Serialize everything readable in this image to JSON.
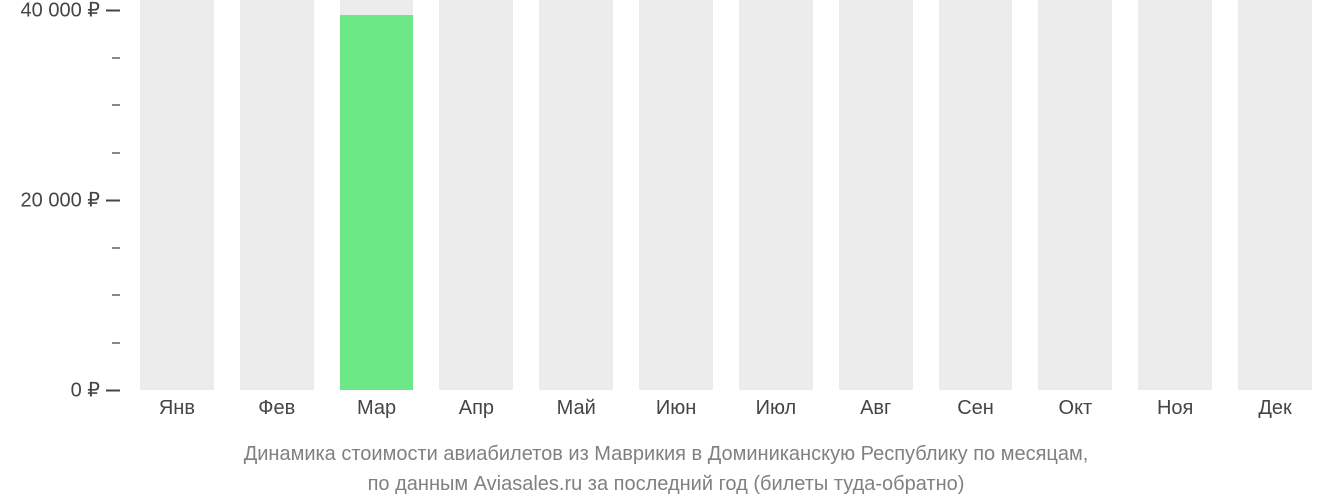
{
  "chart_data": {
    "type": "bar",
    "categories": [
      "Янв",
      "Фев",
      "Мар",
      "Апр",
      "Май",
      "Июн",
      "Июл",
      "Авг",
      "Сен",
      "Окт",
      "Ноя",
      "Дек"
    ],
    "values": [
      null,
      null,
      39500,
      null,
      null,
      null,
      null,
      null,
      null,
      null,
      null,
      null
    ],
    "ylabel": "",
    "xlabel": "",
    "ylim": [
      0,
      40000
    ],
    "y_ticks_major": [
      0,
      20000,
      40000
    ],
    "y_ticks_minor": [
      5000,
      10000,
      15000,
      25000,
      30000,
      35000
    ],
    "y_tick_labels": [
      "0 ₽",
      "20 000 ₽",
      "40 000 ₽"
    ],
    "title_line1": "Динамика стоимости авиабилетов из Маврикия в Доминиканскую Республику по месяцам,",
    "title_line2": "по данным Aviasales.ru за последний год (билеты туда-обратно)"
  },
  "colors": {
    "bar_bg": "#ececec",
    "bar_data": "#6de887",
    "text": "#454545",
    "caption": "#808080"
  }
}
